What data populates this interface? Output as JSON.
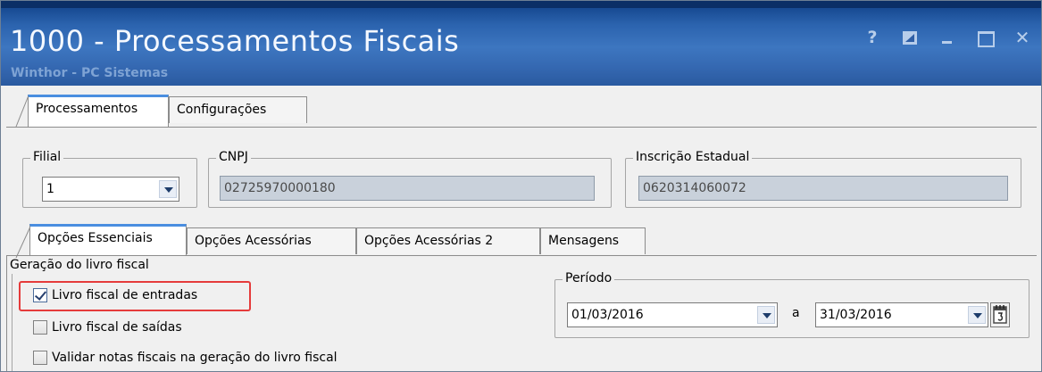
{
  "window": {
    "title": "1000 - Processamentos Fiscais",
    "subtitle": "Winthor - PC Sistemas",
    "controls": [
      "help-icon",
      "restore-icon",
      "minimize-icon",
      "maximize-icon",
      "close-icon"
    ],
    "help_glyph": "?",
    "close_glyph": "✕"
  },
  "tabs_top": [
    {
      "label": "Processamentos",
      "active": true
    },
    {
      "label": "Configurações",
      "active": false
    }
  ],
  "filial": {
    "label": "Filial",
    "value": "1"
  },
  "cnpj": {
    "label": "CNPJ",
    "value": "02725970000180"
  },
  "ie": {
    "label": "Inscrição Estadual",
    "value": "0620314060072"
  },
  "tabs_bottom": [
    {
      "label": "Opções Essenciais",
      "active": true
    },
    {
      "label": "Opções Acessórias",
      "active": false
    },
    {
      "label": "Opções Acessórias 2",
      "active": false
    },
    {
      "label": "Mensagens",
      "active": false
    }
  ],
  "geracao": {
    "label": "Geração do livro fiscal",
    "options": [
      {
        "label": "Livro fiscal de entradas",
        "checked": true
      },
      {
        "label": "Livro fiscal de saídas",
        "checked": false
      },
      {
        "label": "Validar notas fiscais na geração do livro fiscal",
        "checked": false
      }
    ]
  },
  "periodo": {
    "label": "Período",
    "start": "01/03/2016",
    "separator": "a",
    "end": "31/03/2016"
  },
  "colors": {
    "titlebar": "#3d76c0",
    "highlight": "#e53b3b",
    "active_tab_accent": "#4a8ee0"
  }
}
